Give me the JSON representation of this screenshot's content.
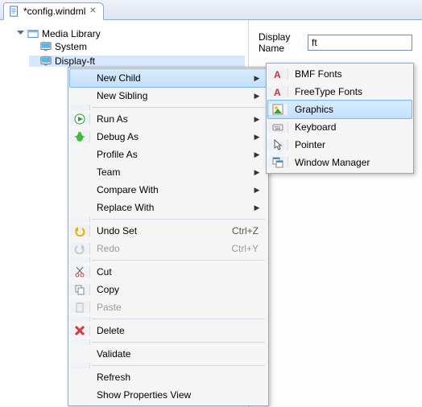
{
  "tab": {
    "title": "*config.windml"
  },
  "tree": {
    "root": "Media Library",
    "system": "System",
    "display": "Display-ft"
  },
  "props": {
    "displayNameLabel": "Display Name",
    "displayNameValue": "ft"
  },
  "ctx": {
    "newChild": "New Child",
    "newSibling": "New Sibling",
    "runAs": "Run As",
    "debugAs": "Debug As",
    "profileAs": "Profile As",
    "team": "Team",
    "compareWith": "Compare With",
    "replaceWith": "Replace With",
    "undoSet": "Undo Set",
    "redo": "Redo",
    "undoShortcut": "Ctrl+Z",
    "redoShortcut": "Ctrl+Y",
    "cut": "Cut",
    "copy": "Copy",
    "paste": "Paste",
    "delete": "Delete",
    "validate": "Validate",
    "refresh": "Refresh",
    "showProps": "Show Properties View"
  },
  "sub": {
    "bmf": "BMF Fonts",
    "freetype": "FreeType Fonts",
    "graphics": "Graphics",
    "keyboard": "Keyboard",
    "pointer": "Pointer",
    "wm": "Window Manager"
  }
}
